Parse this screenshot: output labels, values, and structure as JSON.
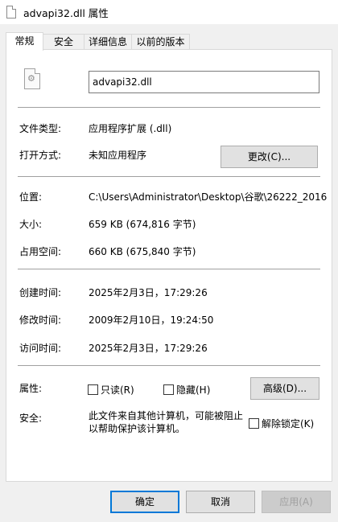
{
  "window": {
    "title": "advapi32.dll 属性"
  },
  "tabs": [
    {
      "label": "常规",
      "active": true
    },
    {
      "label": "安全",
      "active": false
    },
    {
      "label": "详细信息",
      "active": false
    },
    {
      "label": "以前的版本",
      "active": false
    }
  ],
  "file": {
    "name": "advapi32.dll"
  },
  "info": {
    "type_label": "文件类型:",
    "type_value": "应用程序扩展 (.dll)",
    "opens_label": "打开方式:",
    "opens_value": "未知应用程序",
    "change_button": "更改(C)...",
    "location_label": "位置:",
    "location_value": "C:\\Users\\Administrator\\Desktop\\谷歌\\26222_2016",
    "size_label": "大小:",
    "size_value": "659 KB (674,816 字节)",
    "size_on_disk_label": "占用空间:",
    "size_on_disk_value": "660 KB (675,840 字节)",
    "created_label": "创建时间:",
    "created_value": "2025年2月3日，17:29:26",
    "modified_label": "修改时间:",
    "modified_value": "2009年2月10日，19:24:50",
    "accessed_label": "访问时间:",
    "accessed_value": "2025年2月3日，17:29:26",
    "attributes_label": "属性:",
    "readonly_label": "只读(R)",
    "hidden_label": "隐藏(H)",
    "advanced_button": "高级(D)...",
    "security_label": "安全:",
    "security_text": "此文件来自其他计算机，可能被阻止以帮助保护该计算机。",
    "unblock_label": "解除锁定(K)"
  },
  "footer": {
    "ok": "确定",
    "cancel": "取消",
    "apply": "应用(A)"
  }
}
